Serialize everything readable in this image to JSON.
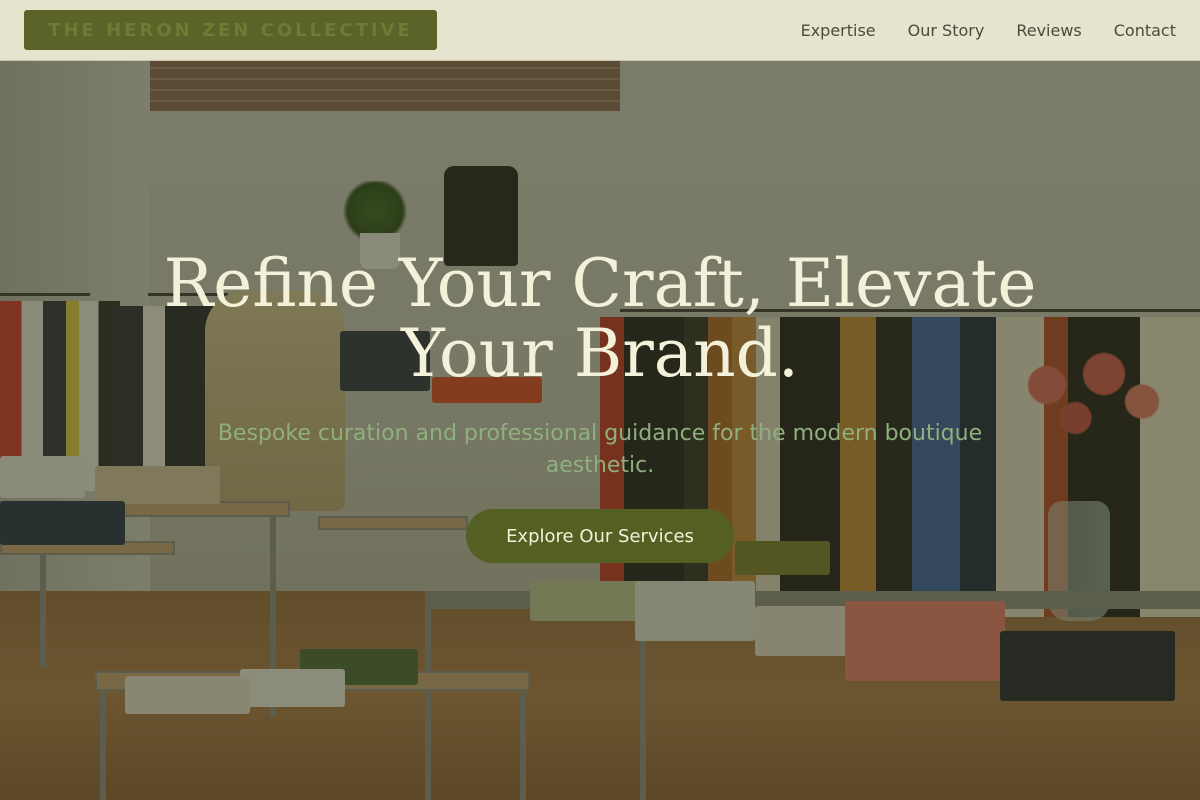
{
  "brand": {
    "name": "THE HERON ZEN COLLECTIVE"
  },
  "nav": {
    "items": [
      {
        "label": "Expertise"
      },
      {
        "label": "Our Story"
      },
      {
        "label": "Reviews"
      },
      {
        "label": "Contact"
      }
    ]
  },
  "hero": {
    "title": "Refine Your Craft, Elevate Your Brand.",
    "subtitle": "Bespoke curation and professional guidance for the modern boutique aesthetic.",
    "cta_label": "Explore Our Services",
    "background_image": "clothing-boutique-interior-photo"
  },
  "colors": {
    "header_bg": "#e6e4cf",
    "logo_bg": "#5b6328",
    "accent": "#545f22",
    "title_text": "#f4f1db",
    "subtitle_text": "#8fb07e"
  }
}
